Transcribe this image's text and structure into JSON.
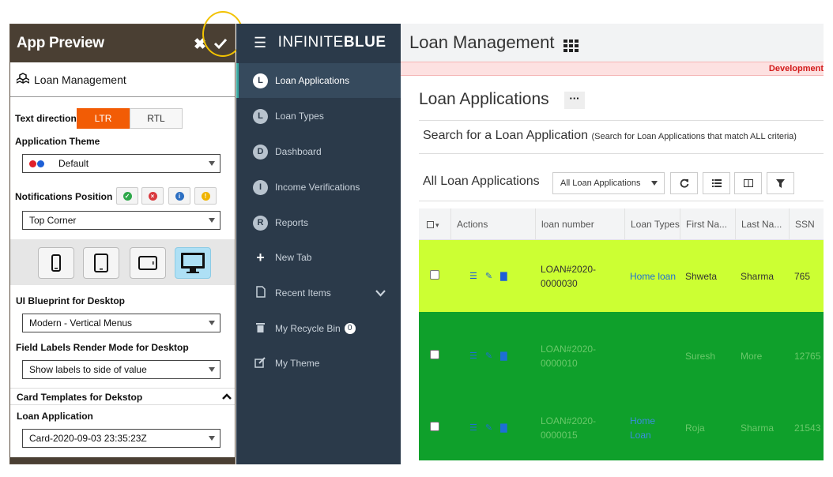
{
  "preview": {
    "title": "App Preview",
    "close_label": "✖",
    "module_name": "Loan Management",
    "text_direction_label": "Text direction",
    "ltr_label": "LTR",
    "rtl_label": "RTL",
    "theme_label": "Application Theme",
    "theme_value": "Default",
    "notifications_label": "Notifications Position",
    "notifications_value": "Top Corner",
    "blueprint_label": "UI Blueprint for Desktop",
    "blueprint_value": "Modern - Vertical Menus",
    "field_labels_label": "Field Labels Render Mode for Desktop",
    "field_labels_value": "Show labels to side of value",
    "card_templates_label": "Card Templates for Dekstop",
    "loan_app_label": "Loan Application",
    "card_value": "Card-2020-09-03 23:35:23Z",
    "colors": {
      "header": "#4a3f33",
      "active_seg": "#f25c05"
    }
  },
  "sidebar": {
    "brand_light": "INFINITE",
    "brand_bold": "BLUE",
    "items": [
      {
        "badge": "L",
        "label": "Loan Applications",
        "active": true
      },
      {
        "badge": "L",
        "label": "Loan Types"
      },
      {
        "badge": "D",
        "label": "Dashboard"
      },
      {
        "badge": "I",
        "label": "Income Verifications"
      },
      {
        "badge": "R",
        "label": "Reports"
      },
      {
        "icon": "plus-icon",
        "label": "New Tab"
      },
      {
        "icon": "document-icon",
        "label": "Recent Items"
      },
      {
        "icon": "trash-icon",
        "label": "My Recycle Bin",
        "count": "0"
      },
      {
        "icon": "edit-icon",
        "label": "My Theme"
      }
    ]
  },
  "main": {
    "app_title": "Loan Management",
    "banner": "Development",
    "page_title": "Loan Applications",
    "more_label": "···",
    "search_title": "Search for a Loan Application",
    "search_hint": "(Search for Loan Applications that match ALL criteria)",
    "list_title": "All Loan Applications",
    "list_select_value": "All Loan Applications",
    "columns": [
      "Actions",
      "loan number",
      "Loan Types",
      "First Na...",
      "Last Na...",
      "SSN"
    ],
    "rows": [
      {
        "loan_number": [
          "LOAN#2020-",
          "0000030"
        ],
        "loan_type": [
          "Home loan"
        ],
        "first": "Shweta",
        "last": "Sharma",
        "ssn": "765",
        "bg": "#ccff33"
      },
      {
        "loan_number": [
          "LOAN#2020-",
          "0000010"
        ],
        "loan_type": [
          ""
        ],
        "first": "Suresh",
        "last": "More",
        "ssn": "12765",
        "bg": "#0fa02b"
      },
      {
        "loan_number": [
          "LOAN#2020-",
          "0000015"
        ],
        "loan_type": [
          "Home",
          "Loan"
        ],
        "first": "Roja",
        "last": "Sharma",
        "ssn": "21543",
        "bg": "#0fa02b"
      }
    ]
  }
}
